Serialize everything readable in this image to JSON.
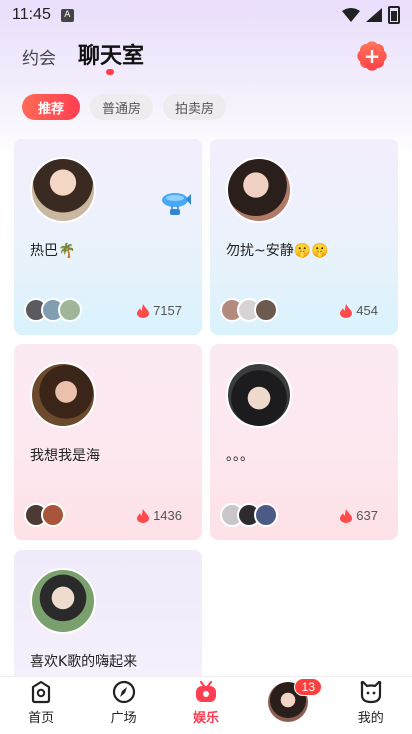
{
  "status_bar": {
    "time": "11:45",
    "app_badge": "A"
  },
  "header": {
    "tab_date": "约会",
    "tab_chatroom": "聊天室",
    "add_icon": "plus-square-icon",
    "accent_color": "#ff3e52"
  },
  "filters": [
    {
      "label": "推荐",
      "active": true
    },
    {
      "label": "普通房",
      "active": false
    },
    {
      "label": "拍卖房",
      "active": false
    }
  ],
  "rooms": [
    {
      "title": "热巴🌴",
      "heat": "7157",
      "style": "blue"
    },
    {
      "title": "勿扰~安静🤫🤫",
      "heat": "454",
      "style": "blue"
    },
    {
      "title": "我想我是海",
      "heat": "1436",
      "style": "pink"
    },
    {
      "title": "。。。",
      "heat": "637",
      "style": "pink"
    },
    {
      "title": "喜欢K歌的嗨起来",
      "heat": "",
      "style": "purple"
    }
  ],
  "bottom_nav": {
    "home": "首页",
    "plaza": "广场",
    "entertainment": "娱乐",
    "messages_badge": "13",
    "mine": "我的"
  }
}
